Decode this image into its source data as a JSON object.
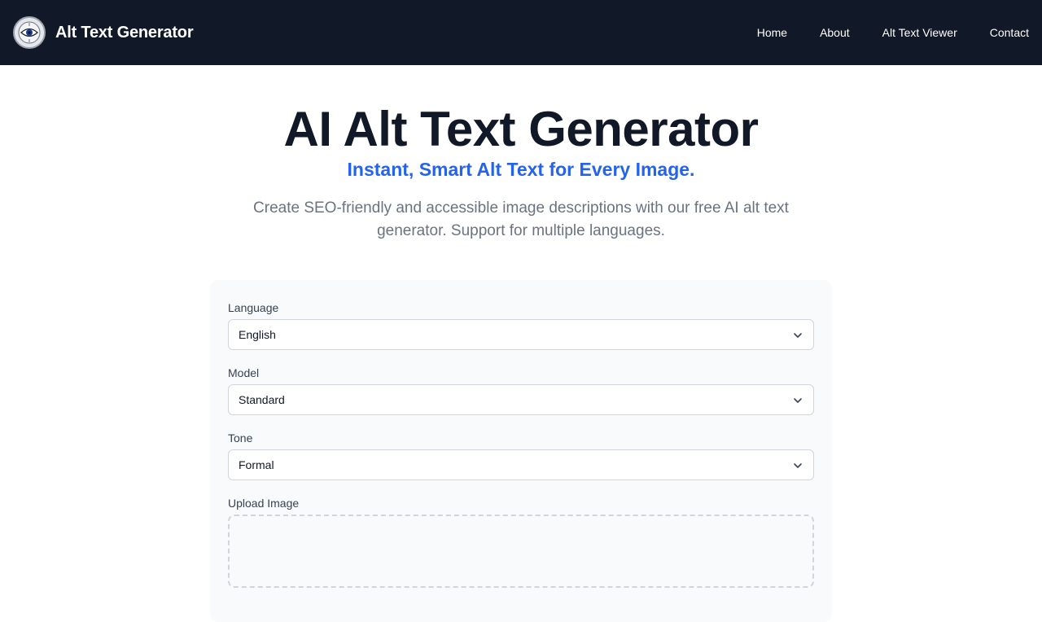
{
  "navbar": {
    "brand_title": "Alt Text Generator",
    "logo_icon": "eye-icon",
    "links": [
      {
        "label": "Home"
      },
      {
        "label": "About"
      },
      {
        "label": "Alt Text Viewer"
      },
      {
        "label": "Contact"
      }
    ]
  },
  "hero": {
    "title": "AI Alt Text Generator",
    "subtitle": "Instant, Smart Alt Text for Every Image.",
    "description": "Create SEO-friendly and accessible image descriptions with our free AI alt text generator. Support for multiple languages."
  },
  "form": {
    "language": {
      "label": "Language",
      "value": "English"
    },
    "model": {
      "label": "Model",
      "value": "Standard"
    },
    "tone": {
      "label": "Tone",
      "value": "Formal"
    },
    "upload": {
      "label": "Upload Image"
    }
  },
  "colors": {
    "navbar_bg": "#111827",
    "accent": "#2563eb",
    "title": "#111827",
    "muted_text": "#6b7280"
  }
}
